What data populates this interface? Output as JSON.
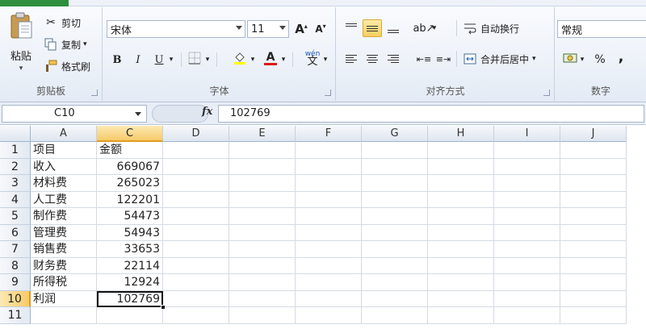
{
  "ribbon": {
    "clipboard": {
      "label": "剪贴板",
      "paste": "粘贴",
      "cut": "剪切",
      "copy": "复制",
      "format_painter": "格式刷"
    },
    "font": {
      "label": "字体",
      "font_name": "宋体",
      "font_size": "11",
      "bold": "B",
      "italic": "I",
      "underline": "U",
      "font_color_glyph": "A",
      "grow": "A",
      "shrink": "A",
      "phonetic": "wén"
    },
    "alignment": {
      "label": "对齐方式",
      "wrap_text": "自动换行",
      "merge_center": "合并后居中"
    },
    "number": {
      "label": "数字",
      "format": "常规",
      "percent": "%",
      "comma": ","
    }
  },
  "formula_bar": {
    "name_box": "C10",
    "fx": "fx",
    "value": "102769"
  },
  "sheet": {
    "columns": [
      {
        "label": "A",
        "selected": false
      },
      {
        "label": "C",
        "selected": true
      },
      {
        "label": "D",
        "selected": false
      },
      {
        "label": "E",
        "selected": false
      },
      {
        "label": "F",
        "selected": false
      },
      {
        "label": "G",
        "selected": false
      },
      {
        "label": "H",
        "selected": false
      },
      {
        "label": "I",
        "selected": false
      },
      {
        "label": "J",
        "selected": false
      }
    ],
    "rows": [
      {
        "n": "1",
        "a": "项目",
        "c": "金额",
        "c_num": false
      },
      {
        "n": "2",
        "a": "收入",
        "c": "669067",
        "c_num": true
      },
      {
        "n": "3",
        "a": "材料费",
        "c": "265023",
        "c_num": true
      },
      {
        "n": "4",
        "a": "人工费",
        "c": "122201",
        "c_num": true
      },
      {
        "n": "5",
        "a": "制作费",
        "c": "54473",
        "c_num": true
      },
      {
        "n": "6",
        "a": "管理费",
        "c": "54943",
        "c_num": true
      },
      {
        "n": "7",
        "a": "销售费",
        "c": "33653",
        "c_num": true
      },
      {
        "n": "8",
        "a": "财务费",
        "c": "22114",
        "c_num": true
      },
      {
        "n": "9",
        "a": "所得税",
        "c": "12924",
        "c_num": true
      },
      {
        "n": "10",
        "a": "利润",
        "c": "102769",
        "c_num": true
      },
      {
        "n": "11",
        "a": "",
        "c": "",
        "c_num": false
      }
    ],
    "active_row": "10",
    "active_col": "C"
  },
  "colors": {
    "selected_header": "#f6cb6a",
    "active_border": "#111111",
    "file_tab": "#2f8f3e"
  }
}
